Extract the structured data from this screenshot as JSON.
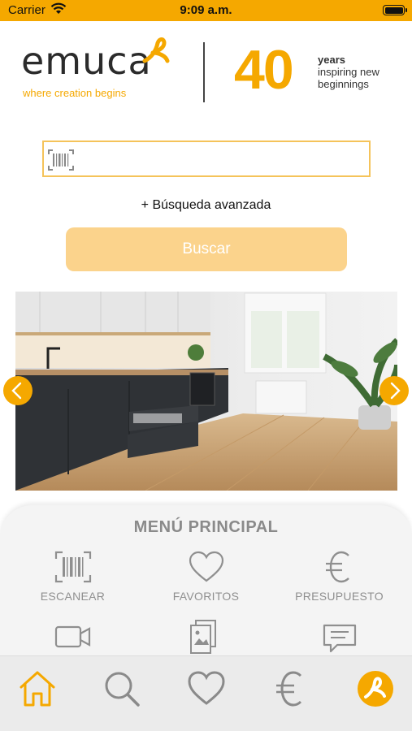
{
  "status_bar": {
    "carrier": "Carrier",
    "time": "9:09 a.m."
  },
  "brand": {
    "logo_text": "emuca",
    "tagline": "where creation begins",
    "anniversary_number": "40",
    "anniversary_line1": "years",
    "anniversary_line2": "inspiring new",
    "anniversary_line3": "beginnings",
    "accent_color": "#f5a800"
  },
  "search": {
    "value": "",
    "placeholder": "",
    "advanced_label": "+ Búsqueda avanzada",
    "button_label": "Buscar"
  },
  "banner": {
    "image_subject": "modern-kitchen-photo",
    "icon_prev": "chevron-left-icon",
    "icon_next": "chevron-right-icon"
  },
  "main_menu": {
    "title": "MENÚ PRINCIPAL",
    "items": [
      {
        "label": "ESCANEAR",
        "icon": "barcode-icon"
      },
      {
        "label": "FAVORITOS",
        "icon": "heart-icon"
      },
      {
        "label": "PRESUPUESTO",
        "icon": "euro-icon"
      },
      {
        "label": "",
        "icon": "video-icon"
      },
      {
        "label": "",
        "icon": "catalog-icon"
      },
      {
        "label": "",
        "icon": "message-icon"
      }
    ]
  },
  "tab_bar": {
    "tabs": [
      {
        "icon": "home-icon",
        "active": true
      },
      {
        "icon": "search-icon",
        "active": false
      },
      {
        "icon": "heart-icon",
        "active": false
      },
      {
        "icon": "euro-icon",
        "active": false
      },
      {
        "icon": "emuca-logo-icon",
        "active": false
      }
    ],
    "active_color": "#f5a800",
    "inactive_color": "#8a8a8a"
  }
}
